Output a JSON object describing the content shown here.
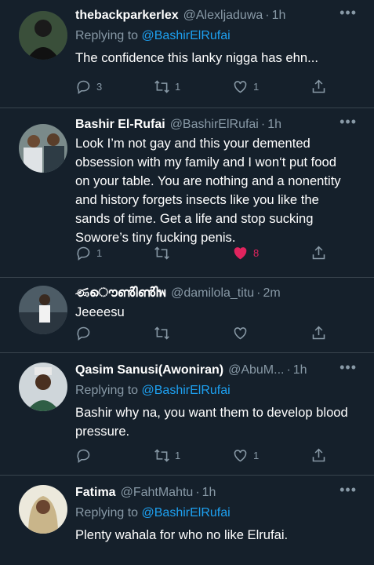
{
  "tweets": [
    {
      "name": "thebackparkerlex",
      "handle": "@Alexljaduwa",
      "time": "1h",
      "replying_prefix": "Replying to ",
      "replying_to": "@BashirElRufai",
      "text": "The confidence this lanky nigga has ehn...",
      "stats": {
        "replies": "3",
        "retweets": "1",
        "likes": "1"
      },
      "liked": false
    },
    {
      "name": "Bashir El-Rufai",
      "handle": "@BashirElRufai",
      "time": "1h",
      "replying_prefix": "",
      "replying_to": "",
      "text": "Look I’m not gay and this your demented obsession with my family and I won‘t put food on your table. You are nothing and a nonentity and history forgets insects like you like the sands of time. Get a life and stop sucking Sowore’s tiny fucking penis.",
      "stats": {
        "replies": "1",
        "retweets": "",
        "likes": "8"
      },
      "liked": true
    },
    {
      "name": "ණൌൺിൺിพ",
      "handle": "@damilola_titu",
      "time": "2m",
      "replying_prefix": "",
      "replying_to": "",
      "text": "Jeeeesu",
      "stats": {
        "replies": "",
        "retweets": "",
        "likes": ""
      },
      "liked": false
    },
    {
      "name": "Qasim Sanusi(Awoniran)",
      "handle": "@AbuM...",
      "time": "1h",
      "replying_prefix": "Replying to ",
      "replying_to": "@BashirElRufai",
      "text": "Bashir why na, you want them to develop blood pressure.",
      "stats": {
        "replies": "",
        "retweets": "1",
        "likes": "1"
      },
      "liked": false
    },
    {
      "name": "Fatima",
      "handle": "@FahtMahtu",
      "time": "1h",
      "replying_prefix": "Replying to ",
      "replying_to": "@BashirElRufai",
      "text": "Plenty wahala for who no like Elrufai.",
      "stats": {
        "replies": "",
        "retweets": "",
        "likes": ""
      },
      "liked": false
    }
  ],
  "colors": {
    "bg": "#15202b",
    "muted": "#8899a6",
    "link": "#1da1f2",
    "like": "#e0245e",
    "divider": "#38444d"
  },
  "icons": [
    "reply-icon",
    "retweet-icon",
    "like-icon",
    "share-icon",
    "more-icon"
  ]
}
